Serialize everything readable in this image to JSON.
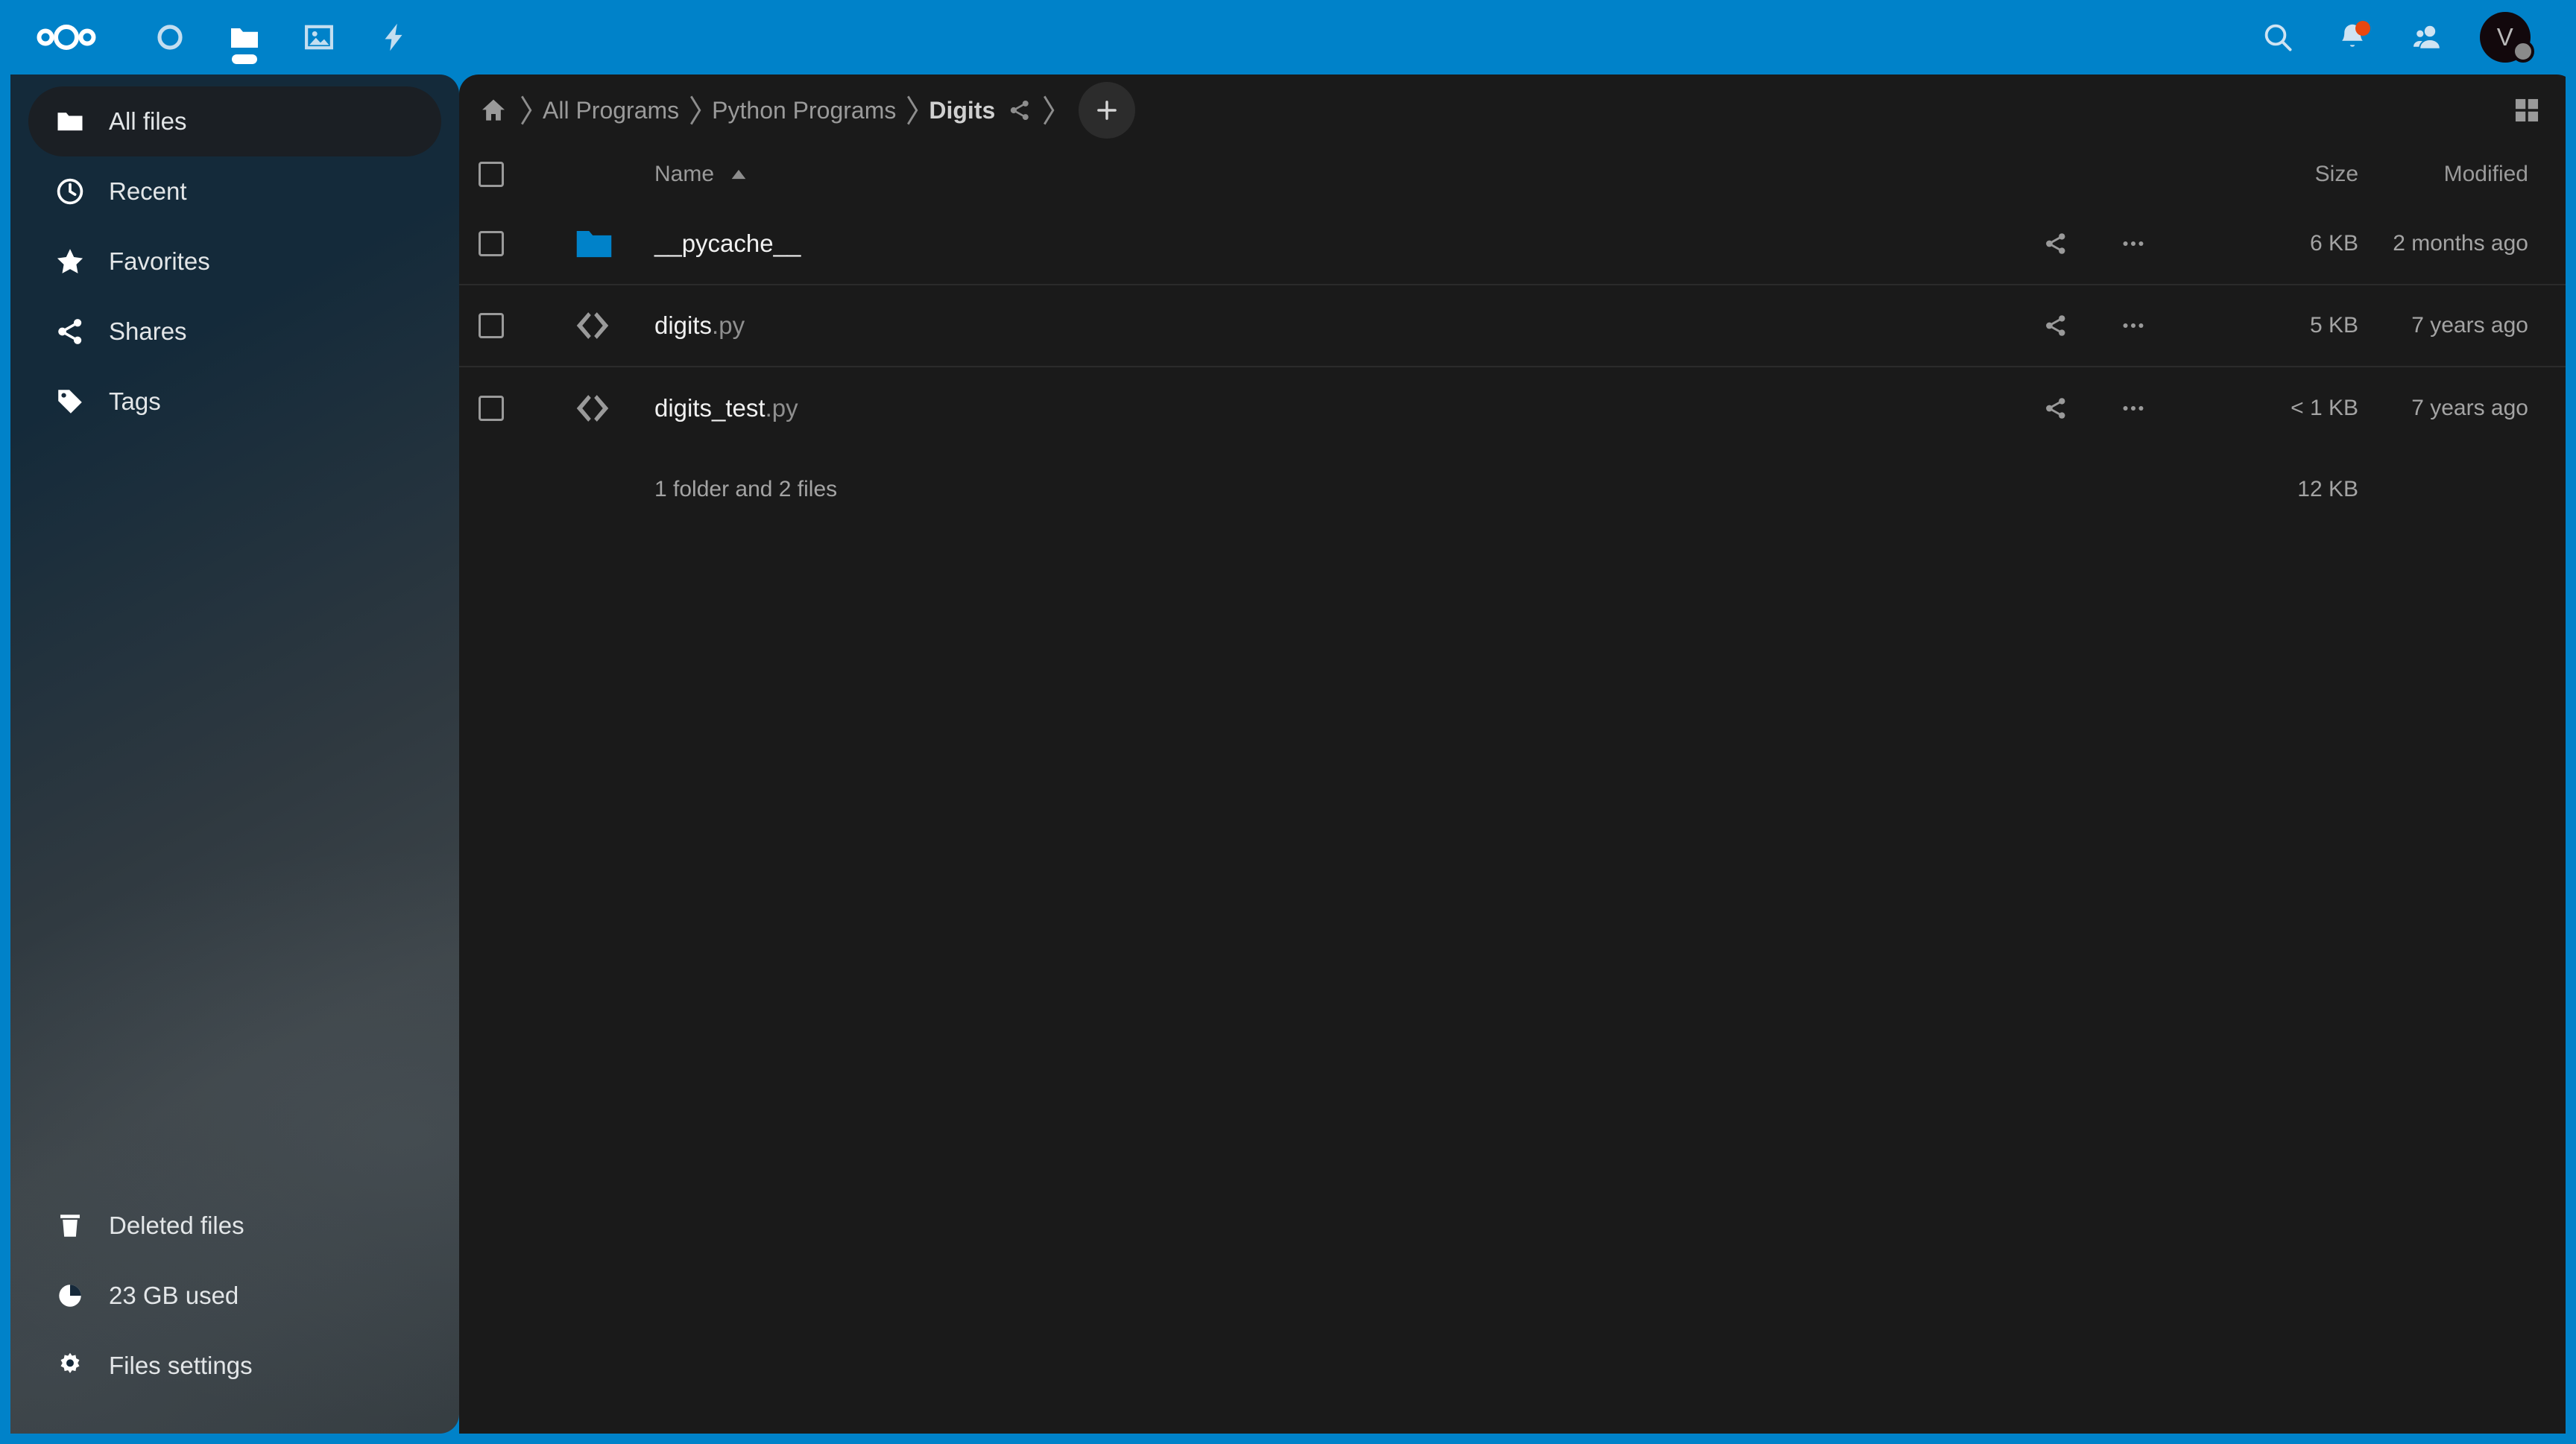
{
  "theme": {
    "primary": "#0082c9",
    "sidebar_bg": "#16293a",
    "content_bg": "#1a1a1a",
    "folder_blue": "#0082c9",
    "notification_badge": "#e8470f"
  },
  "header": {
    "logo_name": "nextcloud-logo",
    "apps": [
      {
        "name": "dashboard",
        "icon": "circle-icon",
        "active": false
      },
      {
        "name": "files",
        "icon": "folder-icon",
        "active": true
      },
      {
        "name": "photos",
        "icon": "photos-icon",
        "active": false
      },
      {
        "name": "activity",
        "icon": "lightning-icon",
        "active": false
      }
    ],
    "actions": [
      {
        "name": "search",
        "icon": "search-icon"
      },
      {
        "name": "notifications",
        "icon": "bell-icon",
        "has_badge": true
      },
      {
        "name": "contacts",
        "icon": "contacts-icon"
      }
    ],
    "avatar": {
      "initial": "V",
      "status": "away"
    }
  },
  "sidebar": {
    "items": [
      {
        "label": "All files",
        "icon": "folder-icon",
        "active": true
      },
      {
        "label": "Recent",
        "icon": "clock-icon",
        "active": false
      },
      {
        "label": "Favorites",
        "icon": "star-icon",
        "active": false
      },
      {
        "label": "Shares",
        "icon": "share-icon",
        "active": false
      },
      {
        "label": "Tags",
        "icon": "tag-icon",
        "active": false
      }
    ],
    "bottom_items": [
      {
        "label": "Deleted files",
        "icon": "trash-icon"
      },
      {
        "label": "23 GB used",
        "icon": "pie-chart-icon"
      },
      {
        "label": "Files settings",
        "icon": "gear-icon"
      }
    ]
  },
  "breadcrumb": {
    "home_icon": "home-icon",
    "crumbs": [
      {
        "label": "All Programs",
        "current": false
      },
      {
        "label": "Python Programs",
        "current": false
      },
      {
        "label": "Digits",
        "current": true
      }
    ],
    "shared_icon": "share-icon",
    "new_button_label": "+",
    "view_toggle_icon": "grid-view-icon"
  },
  "table": {
    "headers": {
      "name": "Name",
      "size": "Size",
      "modified": "Modified"
    },
    "sort": {
      "column": "Name",
      "direction": "asc"
    },
    "rows": [
      {
        "type": "folder",
        "icon": "folder-icon",
        "basename": "__pycache__",
        "extension": "",
        "size": "6 KB",
        "modified": "2 months ago"
      },
      {
        "type": "code",
        "icon": "code-file-icon",
        "basename": "digits",
        "extension": ".py",
        "size": "5 KB",
        "modified": "7 years ago"
      },
      {
        "type": "code",
        "icon": "code-file-icon",
        "basename": "digits_test",
        "extension": ".py",
        "size": "< 1 KB",
        "modified": "7 years ago"
      }
    ],
    "summary": {
      "text": "1 folder and 2 files",
      "total_size": "12 KB"
    },
    "row_actions": [
      {
        "name": "share",
        "icon": "share-icon"
      },
      {
        "name": "more",
        "icon": "ellipsis-icon"
      }
    ]
  }
}
